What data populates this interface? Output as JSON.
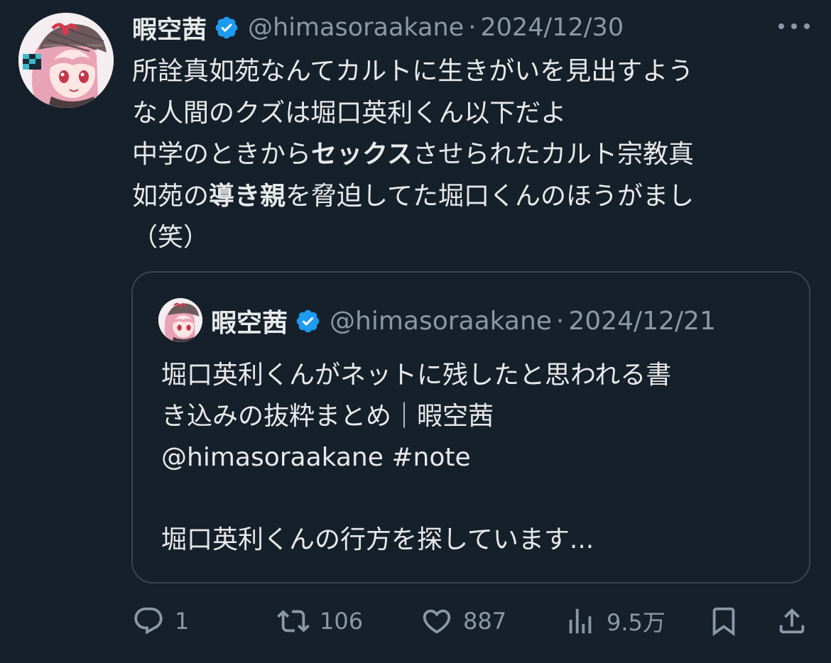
{
  "tweet": {
    "author_name": "暇空茜",
    "handle": "@himasoraakane",
    "separator": "·",
    "date": "2024/12/30",
    "text_lines": [
      [
        {
          "t": "所詮真如苑なんてカルトに生きがいを見出すよう",
          "b": false
        }
      ],
      [
        {
          "t": "な人間のクズは堀口英利くん以下だよ",
          "b": false
        }
      ],
      [
        {
          "t": "中学のときから",
          "b": false
        },
        {
          "t": "セックス",
          "b": true
        },
        {
          "t": "させられたカルト宗教真",
          "b": false
        }
      ],
      [
        {
          "t": "如苑の",
          "b": false
        },
        {
          "t": "導き親",
          "b": true
        },
        {
          "t": "を脅迫してた堀口くんのほうがまし",
          "b": false
        }
      ],
      [
        {
          "t": "（笑）",
          "b": false
        }
      ]
    ],
    "more_icon": "more-horizontal-icon"
  },
  "quote": {
    "author_name": "暇空茜",
    "handle": "@himasoraakane",
    "separator": "·",
    "date": "2024/12/21",
    "text_lines": [
      "堀口英利くんがネットに残したと思われる書",
      "き込みの抜粋まとめ｜暇空茜",
      "@himasoraakane #note",
      "",
      "堀口英利くんの行方を探しています..."
    ]
  },
  "actions": {
    "reply_count": "1",
    "retweet_count": "106",
    "like_count": "887",
    "views_count": "9.5万"
  },
  "colors": {
    "background": "#15202b",
    "text": "#e7e9ea",
    "muted": "#8b98a5",
    "verified": "#1d9bf0",
    "border": "#38444d"
  }
}
